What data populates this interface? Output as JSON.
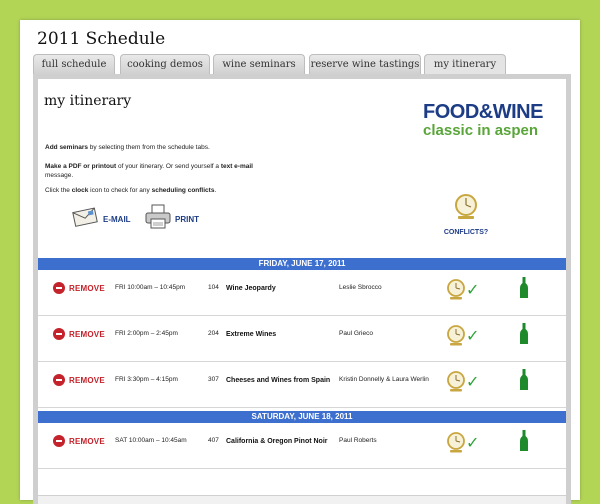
{
  "app": {
    "title": "2011 Schedule"
  },
  "tabs": [
    {
      "label": "full schedule"
    },
    {
      "label": "cooking demos"
    },
    {
      "label": "wine seminars"
    },
    {
      "label": "reserve wine tastings"
    },
    {
      "label": "my itinerary",
      "active": true
    }
  ],
  "itinerary": {
    "title": "my itinerary",
    "brand": {
      "line1": "FOOD&WINE",
      "line2": "classic in aspen",
      "color1": "#1d3c86",
      "color2": "#59a53a"
    },
    "help": {
      "p1_bold": "Add seminars",
      "p1_rest": " by selecting them from the schedule tabs.",
      "p2_bold1": "Make a PDF or printout",
      "p2_mid": " of your itinerary. Or send yourself a ",
      "p2_bold2": "text e-mail",
      "p2_rest": " message.",
      "p3_start": "Click the ",
      "p3_bold1": "clock",
      "p3_mid": " icon to check for any ",
      "p3_bold2": "scheduling conflicts",
      "p3_end": "."
    },
    "email_label": "E-MAIL",
    "print_label": "PRINT",
    "conflicts_label": "CONFLICTS?",
    "days": [
      {
        "header": "FRIDAY, JUNE 17, 2011",
        "events": [
          {
            "remove": "REMOVE",
            "time": "FRI 10:00am – 10:45pm",
            "num": "104",
            "title": "Wine Jeopardy",
            "host": "Leslie Sbrocco"
          },
          {
            "remove": "REMOVE",
            "time": "FRI 2:00pm – 2:45pm",
            "num": "204",
            "title": "Extreme Wines",
            "host": "Paul Grieco"
          },
          {
            "remove": "REMOVE",
            "time": "FRI 3:30pm – 4:15pm",
            "num": "307",
            "title": "Cheeses and Wines from Spain",
            "host": "Kristin Donnelly & Laura Werlin"
          }
        ]
      },
      {
        "header": "SATURDAY, JUNE 18, 2011",
        "events": [
          {
            "remove": "REMOVE",
            "time": "SAT 10:00am – 10:45am",
            "num": "407",
            "title": "California & Oregon Pinot Noir",
            "host": "Paul Roberts"
          }
        ]
      }
    ]
  },
  "colors": {
    "accent": "#3d6fce",
    "remove": "#c4232b",
    "check": "#2fa33a",
    "bottle": "#1e8a2b",
    "clock": "#c8a640"
  },
  "icons": {
    "remove": "remove-icon",
    "email": "envelope-icon",
    "print": "printer-icon",
    "clock": "clock-icon",
    "check": "checkmark-icon",
    "bottle": "wine-bottle-icon"
  }
}
